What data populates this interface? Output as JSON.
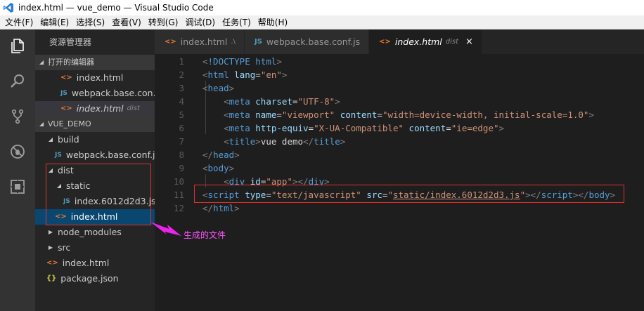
{
  "window": {
    "title": "index.html — vue_demo — Visual Studio Code"
  },
  "menu": [
    "文件(F)",
    "编辑(E)",
    "选择(S)",
    "查看(V)",
    "转到(G)",
    "调试(D)",
    "任务(T)",
    "帮助(H)"
  ],
  "activity": [
    "files-icon",
    "search-icon",
    "source-control-icon",
    "debug-icon",
    "extensions-icon"
  ],
  "sidebar": {
    "header": "资源管理器",
    "open_editors_label": "打开的编辑器",
    "open_editors": [
      {
        "name": "index.html",
        "kind": "html",
        "hint": ""
      },
      {
        "name": "webpack.base.con...",
        "kind": "js",
        "hint": ""
      },
      {
        "name": "index.html",
        "kind": "html",
        "hint": "dist"
      }
    ],
    "project_label": "VUE_DEMO",
    "tree": [
      {
        "name": "build",
        "kind": "folder",
        "open": true
      },
      {
        "name": "webpack.base.conf.js",
        "kind": "js"
      },
      {
        "name": "dist",
        "kind": "folder",
        "open": true
      },
      {
        "name": "static",
        "kind": "folder",
        "open": true
      },
      {
        "name": "index.6012d2d3.js",
        "kind": "js"
      },
      {
        "name": "index.html",
        "kind": "html"
      },
      {
        "name": "node_modules",
        "kind": "folder",
        "open": false
      },
      {
        "name": "src",
        "kind": "folder",
        "open": false
      },
      {
        "name": "index.html",
        "kind": "html"
      },
      {
        "name": "package.json",
        "kind": "json"
      }
    ]
  },
  "tabs": [
    {
      "name": "index.html",
      "sub": ".\\",
      "kind": "html"
    },
    {
      "name": "webpack.base.conf.js",
      "sub": "",
      "kind": "js"
    },
    {
      "name": "index.html",
      "sub": "dist",
      "kind": "html",
      "close": "×"
    }
  ],
  "icons": {
    "html": "<>",
    "js": "JS",
    "json": "{}"
  },
  "editor": {
    "line_numbers": [
      "1",
      "2",
      "3",
      "4",
      "5",
      "6",
      "7",
      "8",
      "9",
      "10",
      "11",
      "12"
    ],
    "lines": [
      [
        [
          "brk",
          "<"
        ],
        [
          "tag",
          "!DOCTYPE"
        ],
        [
          "txt",
          " "
        ],
        [
          "tag",
          "html"
        ],
        [
          "brk",
          ">"
        ]
      ],
      [
        [
          "brk",
          "<"
        ],
        [
          "tag",
          "html"
        ],
        [
          "txt",
          " "
        ],
        [
          "attr",
          "lang"
        ],
        [
          "txt",
          "="
        ],
        [
          "str",
          "\"en\""
        ],
        [
          "brk",
          ">"
        ]
      ],
      [
        [
          "brk",
          "<"
        ],
        [
          "tag",
          "head"
        ],
        [
          "brk",
          ">"
        ]
      ],
      [
        [
          "txt",
          "    "
        ],
        [
          "brk",
          "<"
        ],
        [
          "tag",
          "meta"
        ],
        [
          "txt",
          " "
        ],
        [
          "attr",
          "charset"
        ],
        [
          "txt",
          "="
        ],
        [
          "str",
          "\"UTF-8\""
        ],
        [
          "brk",
          ">"
        ]
      ],
      [
        [
          "txt",
          "    "
        ],
        [
          "brk",
          "<"
        ],
        [
          "tag",
          "meta"
        ],
        [
          "txt",
          " "
        ],
        [
          "attr",
          "name"
        ],
        [
          "txt",
          "="
        ],
        [
          "str",
          "\"viewport\""
        ],
        [
          "txt",
          " "
        ],
        [
          "attr",
          "content"
        ],
        [
          "txt",
          "="
        ],
        [
          "str",
          "\"width=device-width, initial-scale=1.0\""
        ],
        [
          "brk",
          ">"
        ]
      ],
      [
        [
          "txt",
          "    "
        ],
        [
          "brk",
          "<"
        ],
        [
          "tag",
          "meta"
        ],
        [
          "txt",
          " "
        ],
        [
          "attr",
          "http-equiv"
        ],
        [
          "txt",
          "="
        ],
        [
          "str",
          "\"X-UA-Compatible\""
        ],
        [
          "txt",
          " "
        ],
        [
          "attr",
          "content"
        ],
        [
          "txt",
          "="
        ],
        [
          "str",
          "\"ie=edge\""
        ],
        [
          "brk",
          ">"
        ]
      ],
      [
        [
          "txt",
          "    "
        ],
        [
          "brk",
          "<"
        ],
        [
          "tag",
          "title"
        ],
        [
          "brk",
          ">"
        ],
        [
          "txt",
          "vue demo"
        ],
        [
          "brk",
          "</"
        ],
        [
          "tag",
          "title"
        ],
        [
          "brk",
          ">"
        ]
      ],
      [
        [
          "brk",
          "</"
        ],
        [
          "tag",
          "head"
        ],
        [
          "brk",
          ">"
        ]
      ],
      [
        [
          "brk",
          "<"
        ],
        [
          "tag",
          "body"
        ],
        [
          "brk",
          ">"
        ]
      ],
      [
        [
          "txt",
          "    "
        ],
        [
          "brk",
          "<"
        ],
        [
          "tag",
          "div"
        ],
        [
          "txt",
          " "
        ],
        [
          "attr",
          "id"
        ],
        [
          "txt",
          "="
        ],
        [
          "str",
          "\"app\""
        ],
        [
          "brk",
          "></"
        ],
        [
          "tag",
          "div"
        ],
        [
          "brk",
          ">"
        ]
      ],
      [
        [
          "brk",
          "<"
        ],
        [
          "tag",
          "script"
        ],
        [
          "txt",
          " "
        ],
        [
          "attr",
          "type"
        ],
        [
          "txt",
          "="
        ],
        [
          "str",
          "\"text/javascript\""
        ],
        [
          "txt",
          " "
        ],
        [
          "attr",
          "src"
        ],
        [
          "txt",
          "="
        ],
        [
          "str",
          "\""
        ],
        [
          "link",
          "static/index.6012d2d3.js"
        ],
        [
          "str",
          "\""
        ],
        [
          "brk",
          "></"
        ],
        [
          "tag",
          "script"
        ],
        [
          "brk",
          "></"
        ],
        [
          "tag",
          "body"
        ],
        [
          "brk",
          ">"
        ]
      ],
      [
        [
          "brk",
          "</"
        ],
        [
          "tag",
          "html"
        ],
        [
          "brk",
          ">"
        ]
      ]
    ]
  },
  "annotation": {
    "text": "生成的文件",
    "color": "#ff55ff",
    "box_color": "#e0302b"
  },
  "colors": {
    "activity_bar": "#333333",
    "sidebar": "#252526",
    "editor": "#1e1e1e",
    "selected_row": "#094771"
  }
}
